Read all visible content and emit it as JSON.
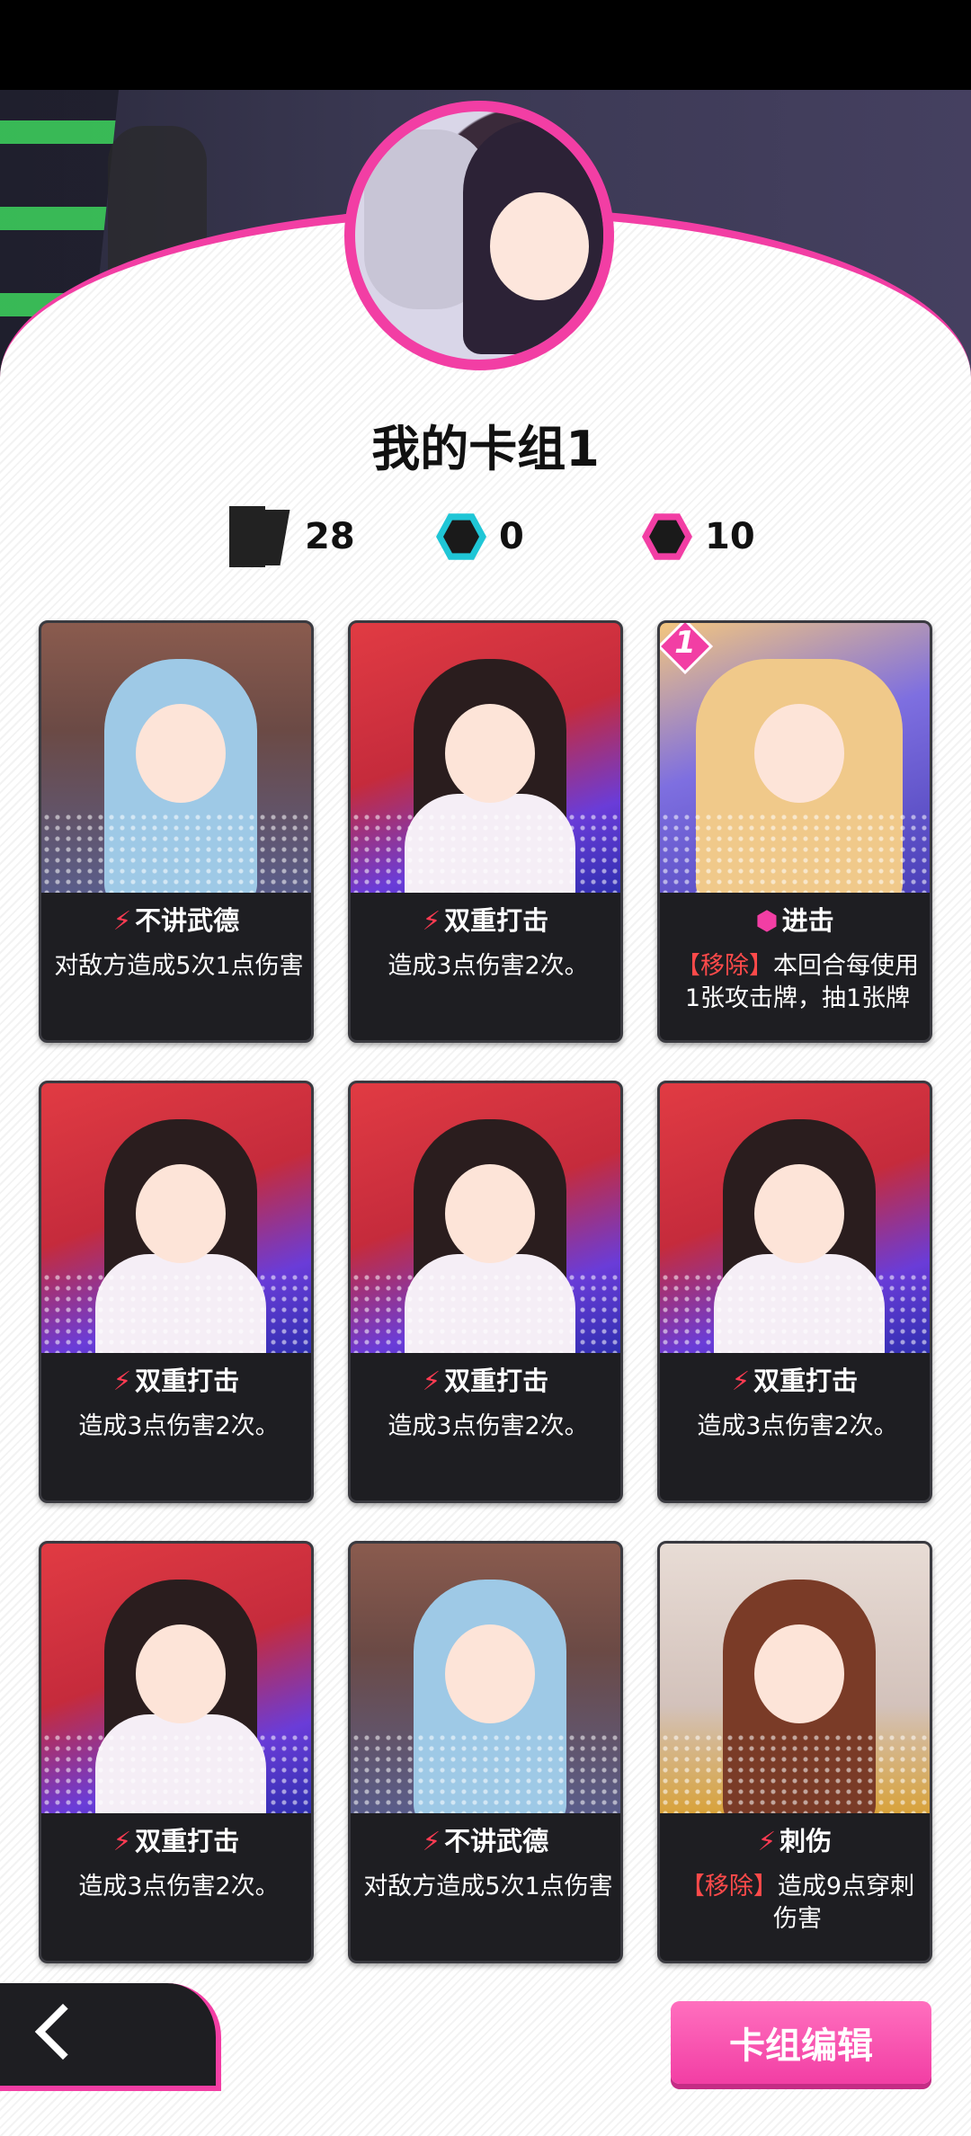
{
  "deck": {
    "name": "我的卡组1",
    "card_count": "28",
    "cyan_count": "0",
    "pink_count": "10"
  },
  "colors": {
    "accent": "#f23ea4",
    "card_bg": "#1e1e22",
    "tag_red": "#ff4a4a"
  },
  "cards": [
    {
      "title": "不讲武德",
      "icon": "lightning-icon",
      "desc": "对敌方造成5次1点伤害",
      "art": "blue-hair-glasses-girl"
    },
    {
      "title": "双重打击",
      "icon": "lightning-icon",
      "desc": "造成3点伤害2次。",
      "art": "umbrella-girl"
    },
    {
      "title": "进击",
      "icon": "hex-icon",
      "tag": "【移除】",
      "desc": "本回合每使用1张攻击牌，抽1张牌",
      "badge": "1",
      "art": "blonde-hat-girl"
    },
    {
      "title": "双重打击",
      "icon": "lightning-icon",
      "desc": "造成3点伤害2次。",
      "art": "umbrella-girl"
    },
    {
      "title": "双重打击",
      "icon": "lightning-icon",
      "desc": "造成3点伤害2次。",
      "art": "umbrella-girl"
    },
    {
      "title": "双重打击",
      "icon": "lightning-icon",
      "desc": "造成3点伤害2次。",
      "art": "umbrella-girl"
    },
    {
      "title": "双重打击",
      "icon": "lightning-icon",
      "desc": "造成3点伤害2次。",
      "art": "umbrella-girl"
    },
    {
      "title": "不讲武德",
      "icon": "lightning-icon",
      "desc": "对敌方造成5次1点伤害",
      "art": "blue-hair-glasses-girl"
    },
    {
      "title": "刺伤",
      "icon": "lightning-icon",
      "tag": "【移除】",
      "desc": "造成9点穿刺伤害",
      "art": "brown-hair-girl"
    }
  ],
  "buttons": {
    "edit": "卡组编辑",
    "back_icon": "chevron-left-icon"
  }
}
